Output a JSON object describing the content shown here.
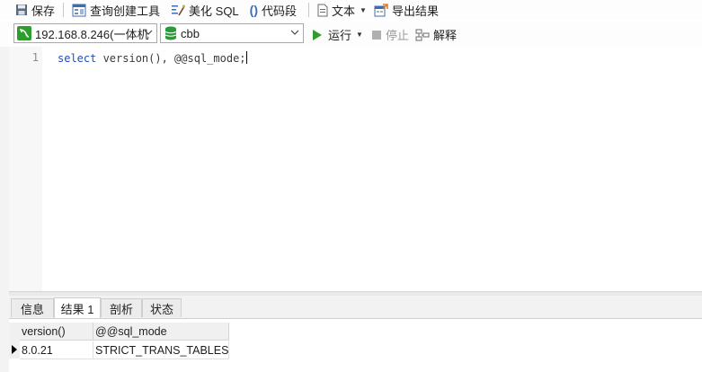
{
  "toolbar": {
    "save": "保存",
    "query_builder": "查询创建工具",
    "beautify_sql": "美化 SQL",
    "code_snippet": "代码段",
    "text": "文本",
    "export_results": "导出结果"
  },
  "connection": {
    "selected": "192.168.8.246(一体机",
    "database": "cbb"
  },
  "actions": {
    "run": "运行",
    "stop": "停止",
    "explain": "解释"
  },
  "editor": {
    "line_number": "1",
    "kw_select": "select",
    "code_rest": " version(), @@sql_mode;"
  },
  "result_tabs": [
    "信息",
    "结果 1",
    "剖析",
    "状态"
  ],
  "result_grid": {
    "columns": [
      "version()",
      "@@sql_mode"
    ],
    "rows": [
      [
        "8.0.21",
        "STRICT_TRANS_TABLES,NO_"
      ]
    ]
  },
  "colors": {
    "run_green": "#2e9d2e",
    "keyword_blue": "#1f4fb8",
    "db_green": "#2a9a3a"
  }
}
